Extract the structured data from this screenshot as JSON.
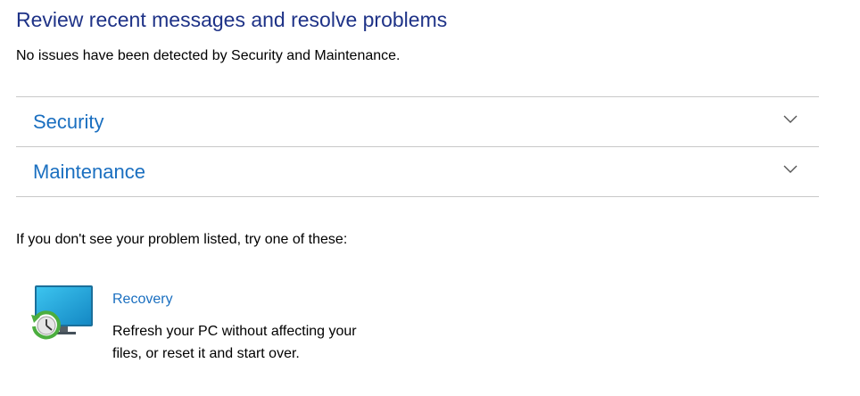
{
  "header": {
    "title": "Review recent messages and resolve problems",
    "subtitle": "No issues have been detected by Security and Maintenance."
  },
  "sections": [
    {
      "label": "Security",
      "icon": "chevron-down-icon",
      "expanded": false
    },
    {
      "label": "Maintenance",
      "icon": "chevron-down-icon",
      "expanded": false
    }
  ],
  "troubleshoot": {
    "intro": "If you don't see your problem listed, try one of these:",
    "options": [
      {
        "title": "Recovery",
        "description": "Refresh your PC without affecting your files, or reset it and start over.",
        "icon": "recovery-monitor-icon"
      }
    ]
  },
  "colors": {
    "title": "#1e3287",
    "link": "#1a6fc0",
    "divider": "#c8c8c8",
    "recovery_green": "#4cae3f",
    "monitor_blue": "#1fa6d8"
  }
}
